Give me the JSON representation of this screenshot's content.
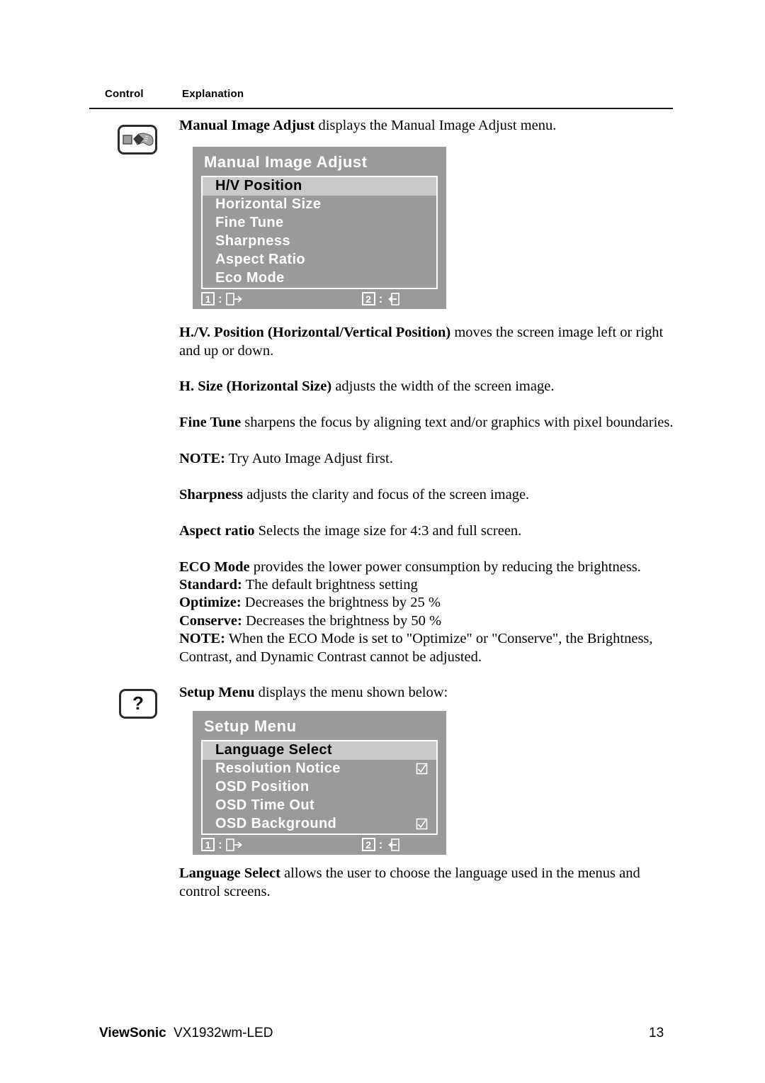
{
  "header": {
    "col_control": "Control",
    "col_explanation": "Explanation"
  },
  "icons": {
    "manual_image_adjust": "wrench-square-icon",
    "setup_menu": "question-mark-icon",
    "question_glyph": "?"
  },
  "sections": [
    {
      "intro_bold": "Manual Image Adjust",
      "intro_rest": " displays the Manual Image Adjust menu."
    }
  ],
  "osd_manual_image_adjust": {
    "title": "Manual Image Adjust",
    "items": [
      {
        "label": "H/V Position",
        "selected": true,
        "checkbox": false
      },
      {
        "label": "Horizontal Size",
        "selected": false,
        "checkbox": false
      },
      {
        "label": "Fine Tune",
        "selected": false,
        "checkbox": false
      },
      {
        "label": "Sharpness",
        "selected": false,
        "checkbox": false
      },
      {
        "label": "Aspect Ratio",
        "selected": false,
        "checkbox": false
      },
      {
        "label": "Eco Mode",
        "selected": false,
        "checkbox": false
      }
    ],
    "footer": {
      "key1": "1",
      "key2": "2",
      "separator": ":",
      "icon1": "exit-right-icon",
      "icon2": "exit-left-icon"
    }
  },
  "osd_setup_menu": {
    "title": "Setup Menu",
    "items": [
      {
        "label": "Language Select",
        "selected": true,
        "checkbox": false
      },
      {
        "label": "Resolution Notice",
        "selected": false,
        "checkbox": true
      },
      {
        "label": "OSD Position",
        "selected": false,
        "checkbox": false
      },
      {
        "label": "OSD Time Out",
        "selected": false,
        "checkbox": false
      },
      {
        "label": "OSD Background",
        "selected": false,
        "checkbox": true
      }
    ],
    "footer": {
      "key1": "1",
      "key2": "2",
      "separator": ":",
      "icon1": "exit-right-icon",
      "icon2": "exit-left-icon"
    }
  },
  "body": {
    "p_intro_bold": "Manual Image Adjust",
    "p_intro_rest": " displays the Manual Image Adjust menu.",
    "p_hv_bold": "H./V. Position (Horizontal/Vertical Position)",
    "p_hv_rest": " moves the screen image left or right and up or down.",
    "p_hsize_bold": "H. Size (Horizontal Size)",
    "p_hsize_rest": " adjusts the width of the screen image.",
    "p_finetune_bold": "Fine Tune",
    "p_finetune_rest": " sharpens the focus by aligning text and/or graphics with pixel boundaries.",
    "p_finetune_note_bold": "NOTE:",
    "p_finetune_note_rest": " Try Auto Image Adjust first.",
    "p_sharpness_bold": "Sharpness",
    "p_sharpness_rest": " adjusts the clarity and focus of the screen image.",
    "p_aspect_bold": "Aspect ratio",
    "p_aspect_rest": " Selects the image size for 4:3 and full screen.",
    "p_eco_bold": "ECO Mode",
    "p_eco_rest": " provides the lower power consumption by reducing the brightness.",
    "p_eco_standard_bold": "Standard:",
    "p_eco_standard_rest": " The default brightness setting",
    "p_eco_optimize_bold": "Optimize:",
    "p_eco_optimize_rest": " Decreases the brightness by 25 %",
    "p_eco_conserve_bold": "Conserve:",
    "p_eco_conserve_rest": " Decreases the brightness by 50 %",
    "p_eco_note_bold": "NOTE:",
    "p_eco_note_rest": " When the ECO Mode is set to \"Optimize\" or \"Conserve\", the Brightness, Contrast, and Dynamic Contrast cannot be adjusted.",
    "p_setup_bold": "Setup Menu",
    "p_setup_rest": " displays the menu shown below:",
    "p_language_bold": "Language Select",
    "p_language_rest": " allows the user to choose the language used in the menus and control screens."
  },
  "footer": {
    "brand": "ViewSonic",
    "model": "VX1932wm-LED",
    "page_number": "13"
  },
  "colors": {
    "osd_background": "#9a9a9a",
    "osd_selected_row": "#c9c9c9",
    "osd_text": "#ffffff",
    "text": "#000000",
    "rule": "#1a1a1a"
  }
}
